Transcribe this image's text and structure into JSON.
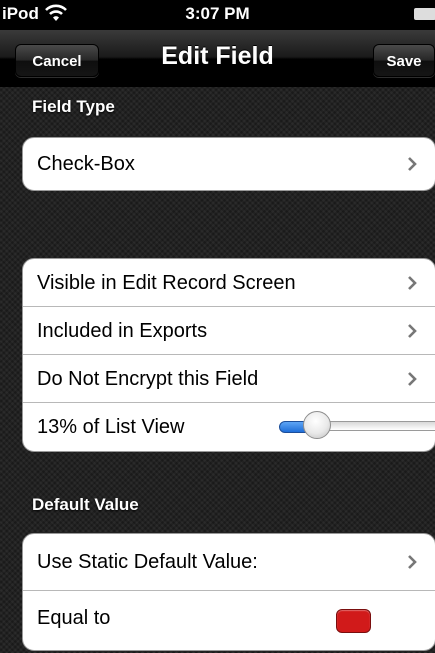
{
  "status_bar": {
    "carrier": "iPod",
    "time": "3:07 PM",
    "wifi_icon": "wifi-icon",
    "battery_icon": "battery-icon"
  },
  "nav": {
    "title": "Edit Field",
    "cancel_label": "Cancel",
    "save_label": "Save"
  },
  "sections": {
    "field_type": {
      "header": "Field Type",
      "value": "Check-Box"
    },
    "options": {
      "rows": [
        "Visible in Edit Record Screen",
        "Included in Exports",
        "Do Not Encrypt this Field"
      ],
      "list_view_label": "13% of List View",
      "list_view_percent": 13
    },
    "default_value": {
      "header": "Default Value",
      "static_label": "Use Static Default Value:",
      "equal_label": "Equal to",
      "equal_color": "#d11a1a"
    }
  },
  "colors": {
    "slider_fill": "#2a7be4"
  }
}
